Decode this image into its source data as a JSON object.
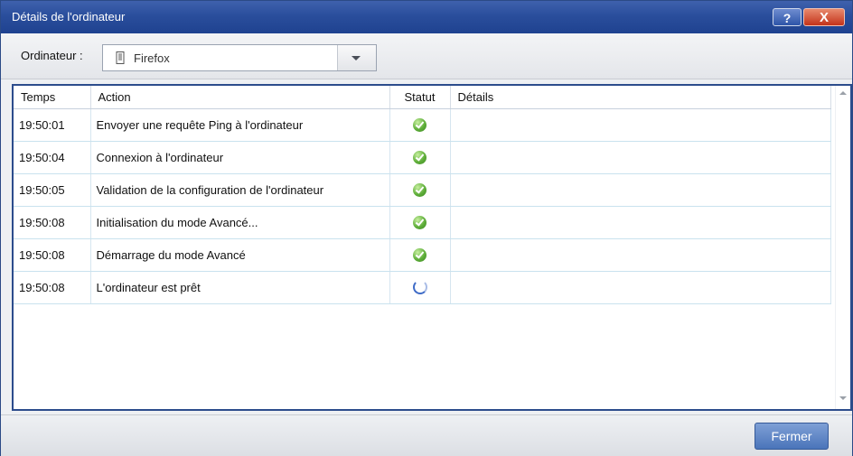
{
  "window": {
    "title": "Détails de l'ordinateur",
    "help_label": "?",
    "close_label": "X"
  },
  "toolbar": {
    "computer_label": "Ordinateur :",
    "computer_value": "Firefox"
  },
  "table": {
    "headers": {
      "time": "Temps",
      "action": "Action",
      "status": "Statut",
      "details": "Détails"
    },
    "rows": [
      {
        "time": "19:50:01",
        "action": "Envoyer une requête Ping à l'ordinateur",
        "status": "success",
        "details": ""
      },
      {
        "time": "19:50:04",
        "action": "Connexion à l'ordinateur",
        "status": "success",
        "details": ""
      },
      {
        "time": "19:50:05",
        "action": "Validation de la configuration de l'ordinateur",
        "status": "success",
        "details": ""
      },
      {
        "time": "19:50:08",
        "action": "Initialisation du mode Avancé...",
        "status": "success",
        "details": ""
      },
      {
        "time": "19:50:08",
        "action": "Démarrage du mode Avancé",
        "status": "success",
        "details": ""
      },
      {
        "time": "19:50:08",
        "action": "L'ordinateur est prêt",
        "status": "in-progress",
        "details": ""
      }
    ]
  },
  "footer": {
    "close_button": "Fermer"
  },
  "icons": {
    "success": "check-circle-icon",
    "in-progress": "spinner-icon",
    "computer": "computer-icon"
  }
}
